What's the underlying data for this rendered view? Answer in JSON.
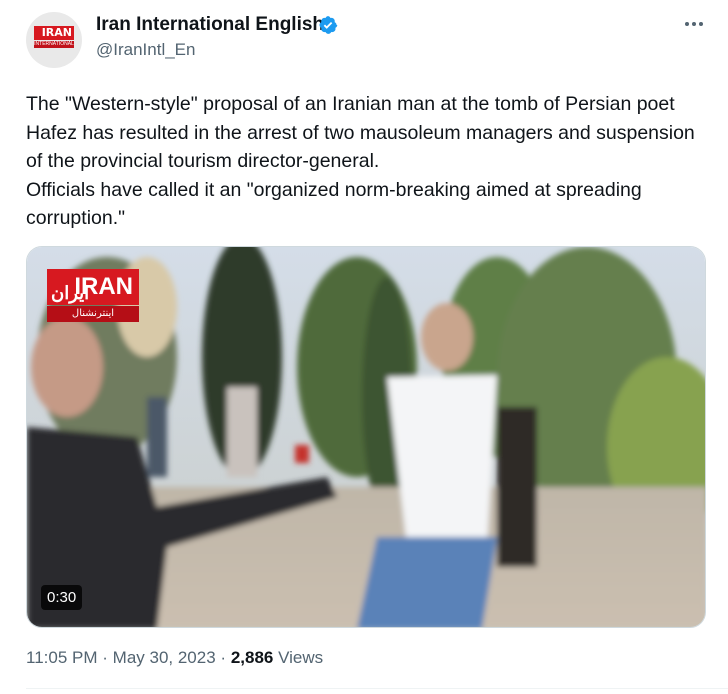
{
  "author": {
    "display_name": "Iran International English",
    "handle": "@IranIntl_En",
    "avatar_logo_text": "IRAN",
    "avatar_logo_sub": "INTERNATIONAL",
    "verified": true
  },
  "tweet": {
    "paragraphs": [
      "The \"Western-style\" proposal of an Iranian man at the tomb of Persian poet Hafez has resulted in the arrest of two mausoleum managers and suspension of the provincial tourism director-general.",
      "Officials have called it an \"organized norm-breaking aimed at spreading corruption.\""
    ]
  },
  "media": {
    "type": "video",
    "duration": "0:30",
    "logo": {
      "latin": "IRAN",
      "farsi": "ایران",
      "strip": "اینترنشنال"
    }
  },
  "footer": {
    "time": "11:05 PM",
    "date": "May 30, 2023",
    "separator": "·",
    "views_count": "2,886",
    "views_label": "Views"
  },
  "colors": {
    "accent_verified": "#1d9bf0",
    "brand_red": "#d71920",
    "secondary_text": "#536471"
  },
  "icons": {
    "verified": "verified-badge-icon",
    "more": "more-options-icon"
  }
}
